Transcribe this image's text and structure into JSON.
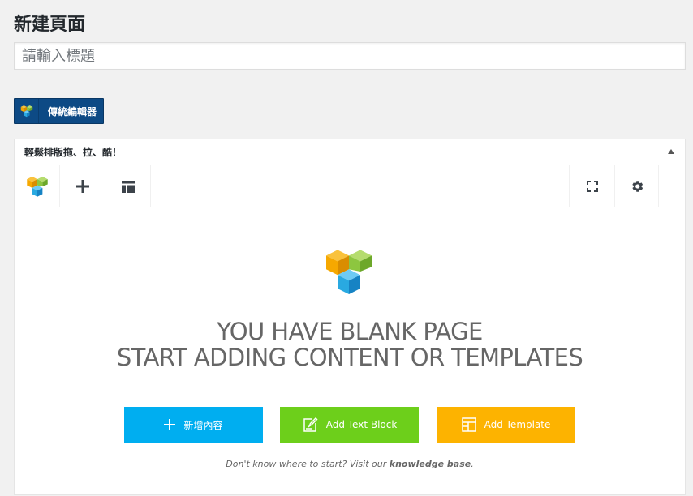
{
  "page": {
    "title": "新建頁面"
  },
  "title_input": {
    "placeholder": "請輸入標題",
    "value": ""
  },
  "classic_editor_button": {
    "label": "傳統編輯器"
  },
  "panel": {
    "header": "輕鬆排版拖、拉、酷！",
    "toggle_icon": "triangle-up-icon"
  },
  "navbar": {
    "left": [
      {
        "name": "vc-logo-icon"
      },
      {
        "name": "plus-icon"
      },
      {
        "name": "layout-template-icon"
      }
    ],
    "right": [
      {
        "name": "fullscreen-icon"
      },
      {
        "name": "gear-icon"
      }
    ]
  },
  "blank_state": {
    "line1": "YOU HAVE BLANK PAGE",
    "line2": "START ADDING CONTENT OR TEMPLATES",
    "buttons": [
      {
        "label": "新增內容",
        "icon": "plus-icon",
        "color": "#00aef0"
      },
      {
        "label": "Add Text Block",
        "icon": "edit-note-icon",
        "color": "#6dcf1b"
      },
      {
        "label": "Add Template",
        "icon": "template-icon",
        "color": "#fdb300"
      }
    ],
    "hint_prefix": "Don't know where to start? Visit our",
    "hint_link": "knowledge base",
    "hint_suffix": "."
  },
  "colors": {
    "classic_btn_bg": "#0d4a85",
    "logo_orange": "#f6a800",
    "logo_green": "#8dc63f",
    "logo_blue": "#29a9e1"
  }
}
